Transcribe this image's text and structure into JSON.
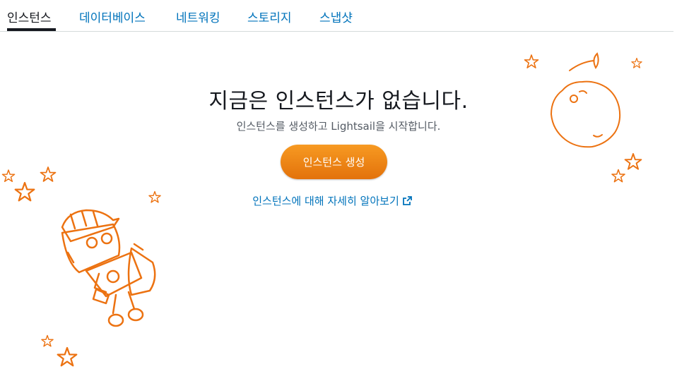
{
  "tabs": [
    {
      "label": "인스턴스",
      "active": true
    },
    {
      "label": "데이터베이스",
      "active": false
    },
    {
      "label": "네트워킹",
      "active": false
    },
    {
      "label": "스토리지",
      "active": false
    },
    {
      "label": "스냅샷",
      "active": false
    }
  ],
  "empty_state": {
    "title": "지금은 인스턴스가 없습니다.",
    "subtitle": "인스턴스를 생성하고 Lightsail을 시작합니다.",
    "create_button": "인스턴스 생성",
    "learn_more": "인스턴스에 대해 자세히 알아보기",
    "learn_more_icon": "external-link-icon"
  },
  "illustration": {
    "robot": "astronaut-robot-illustration",
    "planet": "planet-illustration",
    "stars": "star-icon"
  },
  "colors": {
    "link": "#0073bb",
    "accent": "#ec7211",
    "text": "#16191f",
    "subtext": "#545b64"
  }
}
